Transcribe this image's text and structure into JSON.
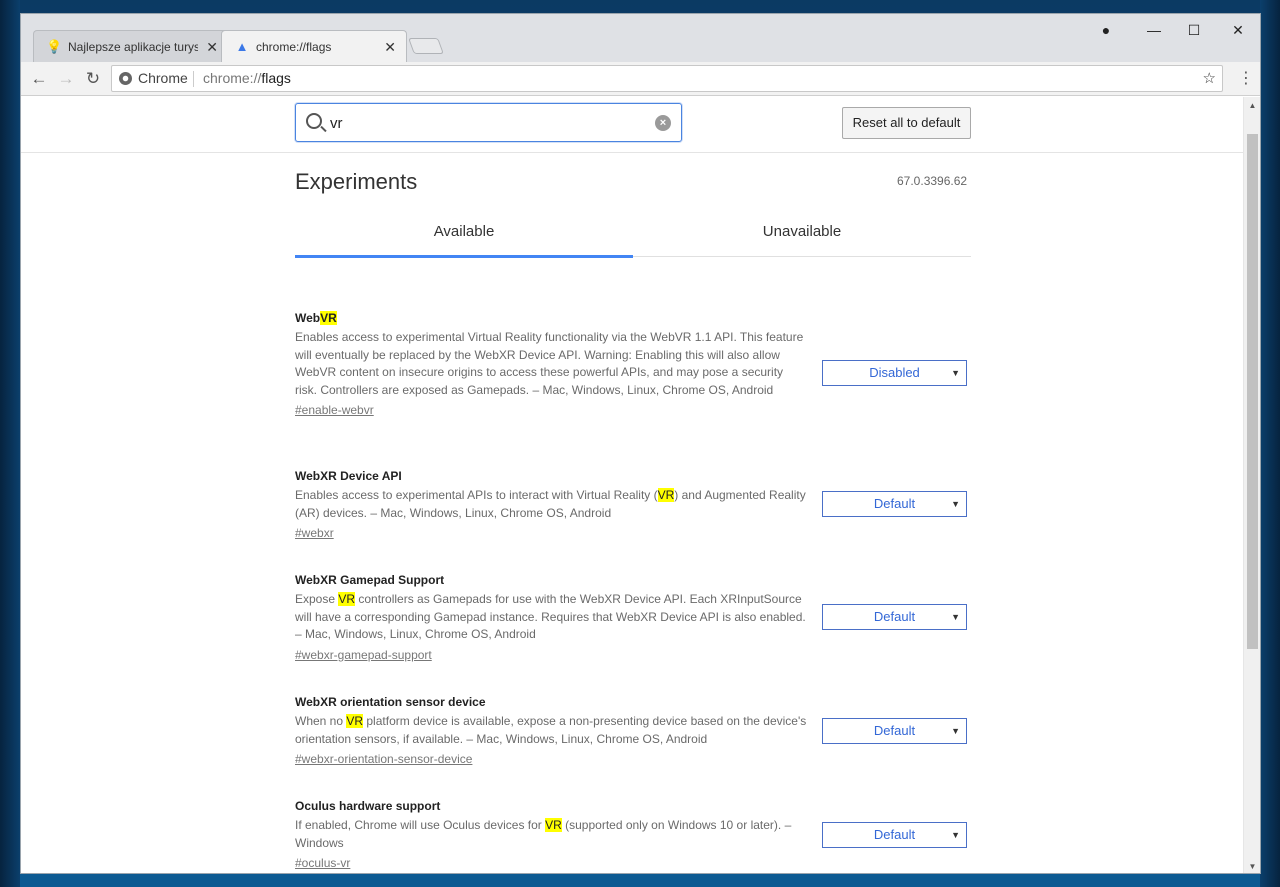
{
  "browser": {
    "tabs": [
      {
        "title": "Najlepsze aplikacje turyst",
        "active": false,
        "favicon": "bulb-icon"
      },
      {
        "title": "chrome://flags",
        "active": true,
        "favicon": "flask-icon"
      }
    ],
    "omnibox": {
      "chip": "Chrome",
      "url_scheme": "chrome://",
      "url_host": "flags"
    }
  },
  "flags": {
    "search_value": "vr",
    "reset_label": "Reset all to default",
    "title": "Experiments",
    "version": "67.0.3396.62",
    "tab_available": "Available",
    "tab_unavailable": "Unavailable",
    "experiments": [
      {
        "name_pre": "Web",
        "name_hl": "VR",
        "name_post": "",
        "desc_pre": "Enables access to experimental Virtual Reality functionality via the WebVR 1.1 API. This feature will eventually be replaced by the WebXR Device API. Warning: Enabling this will also allow WebVR content on insecure origins to access these powerful APIs, and may pose a security risk. Controllers are exposed as Gamepads. – Mac, Windows, Linux, Chrome OS, Android",
        "desc_hl": "",
        "desc_post": "",
        "link": "#enable-webvr",
        "value": "Disabled"
      },
      {
        "name_pre": "WebXR Device API",
        "name_hl": "",
        "name_post": "",
        "desc_pre": "Enables access to experimental APIs to interact with Virtual Reality (",
        "desc_hl": "VR",
        "desc_post": ") and Augmented Reality (AR) devices. – Mac, Windows, Linux, Chrome OS, Android",
        "link": "#webxr",
        "value": "Default"
      },
      {
        "name_pre": "WebXR Gamepad Support",
        "name_hl": "",
        "name_post": "",
        "desc_pre": "Expose ",
        "desc_hl": "VR",
        "desc_post": " controllers as Gamepads for use with the WebXR Device API. Each XRInputSource will have a corresponding Gamepad instance. Requires that WebXR Device API is also enabled. – Mac, Windows, Linux, Chrome OS, Android",
        "link": "#webxr-gamepad-support",
        "value": "Default"
      },
      {
        "name_pre": "WebXR orientation sensor device",
        "name_hl": "",
        "name_post": "",
        "desc_pre": "When no ",
        "desc_hl": "VR",
        "desc_post": " platform device is available, expose a non-presenting device based on the device's orientation sensors, if available. – Mac, Windows, Linux, Chrome OS, Android",
        "link": "#webxr-orientation-sensor-device",
        "value": "Default"
      },
      {
        "name_pre": "Oculus hardware support",
        "name_hl": "",
        "name_post": "",
        "desc_pre": "If enabled, Chrome will use Oculus devices for ",
        "desc_hl": "VR",
        "desc_post": " (supported only on Windows 10 or later). – Windows",
        "link": "#oculus-vr",
        "value": "Default"
      }
    ]
  },
  "colors": {
    "accent": "#4285f4",
    "highlight": "#ffff00"
  }
}
